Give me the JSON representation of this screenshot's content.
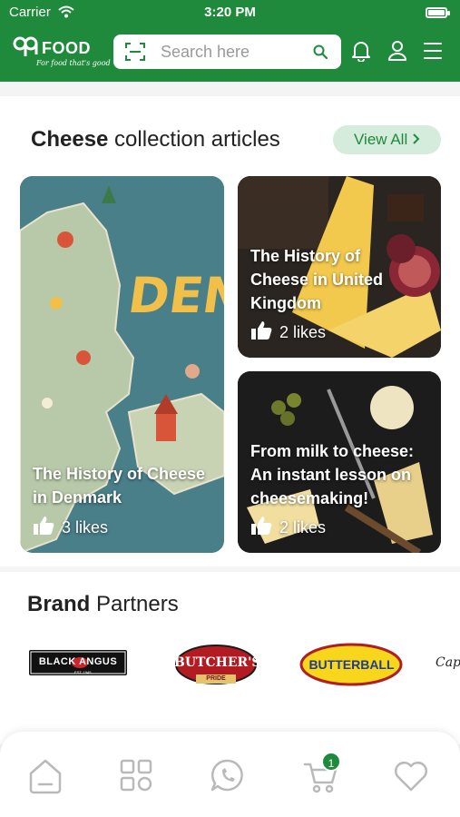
{
  "status": {
    "carrier": "Carrier",
    "time": "3:20 PM"
  },
  "brand": {
    "name": "FOOD",
    "tagline": "For food that's good"
  },
  "search": {
    "placeholder": "Search here"
  },
  "articles": {
    "title_bold": "Cheese",
    "title_rest": " collection articles",
    "view_all": "View All",
    "items": [
      {
        "title": "The History of Cheese in Denmark",
        "likes": "3 likes",
        "image": "denmark-illustrated-map",
        "map_text": "DENM"
      },
      {
        "title": "The History of Cheese in United Kingdom",
        "likes": "2 likes",
        "image": "cheese-wedges-and-figs"
      },
      {
        "title": "From milk to cheese: An instant lesson on cheesemaking!",
        "likes": "2 likes",
        "image": "grated-cheese-and-olives"
      }
    ]
  },
  "partners": {
    "title_bold": "Brand",
    "title_rest": " Partners",
    "logos": [
      {
        "name": "BLACK ANGUS",
        "badge": "EST. 1945"
      },
      {
        "name": "BUTCHER'S",
        "sub": "PRIDE"
      },
      {
        "name": "BUTTERBALL"
      },
      {
        "name": "Capa"
      }
    ]
  },
  "tabs": [
    {
      "name": "home",
      "icon": "home-icon"
    },
    {
      "name": "categories",
      "icon": "grid-icon"
    },
    {
      "name": "whatsapp",
      "icon": "whatsapp-icon"
    },
    {
      "name": "cart",
      "icon": "cart-icon",
      "badge": "1"
    },
    {
      "name": "wishlist",
      "icon": "heart-icon"
    }
  ],
  "colors": {
    "brand": "#1f8a3c",
    "accent_light": "#d5ebdc",
    "text": "#222222"
  }
}
